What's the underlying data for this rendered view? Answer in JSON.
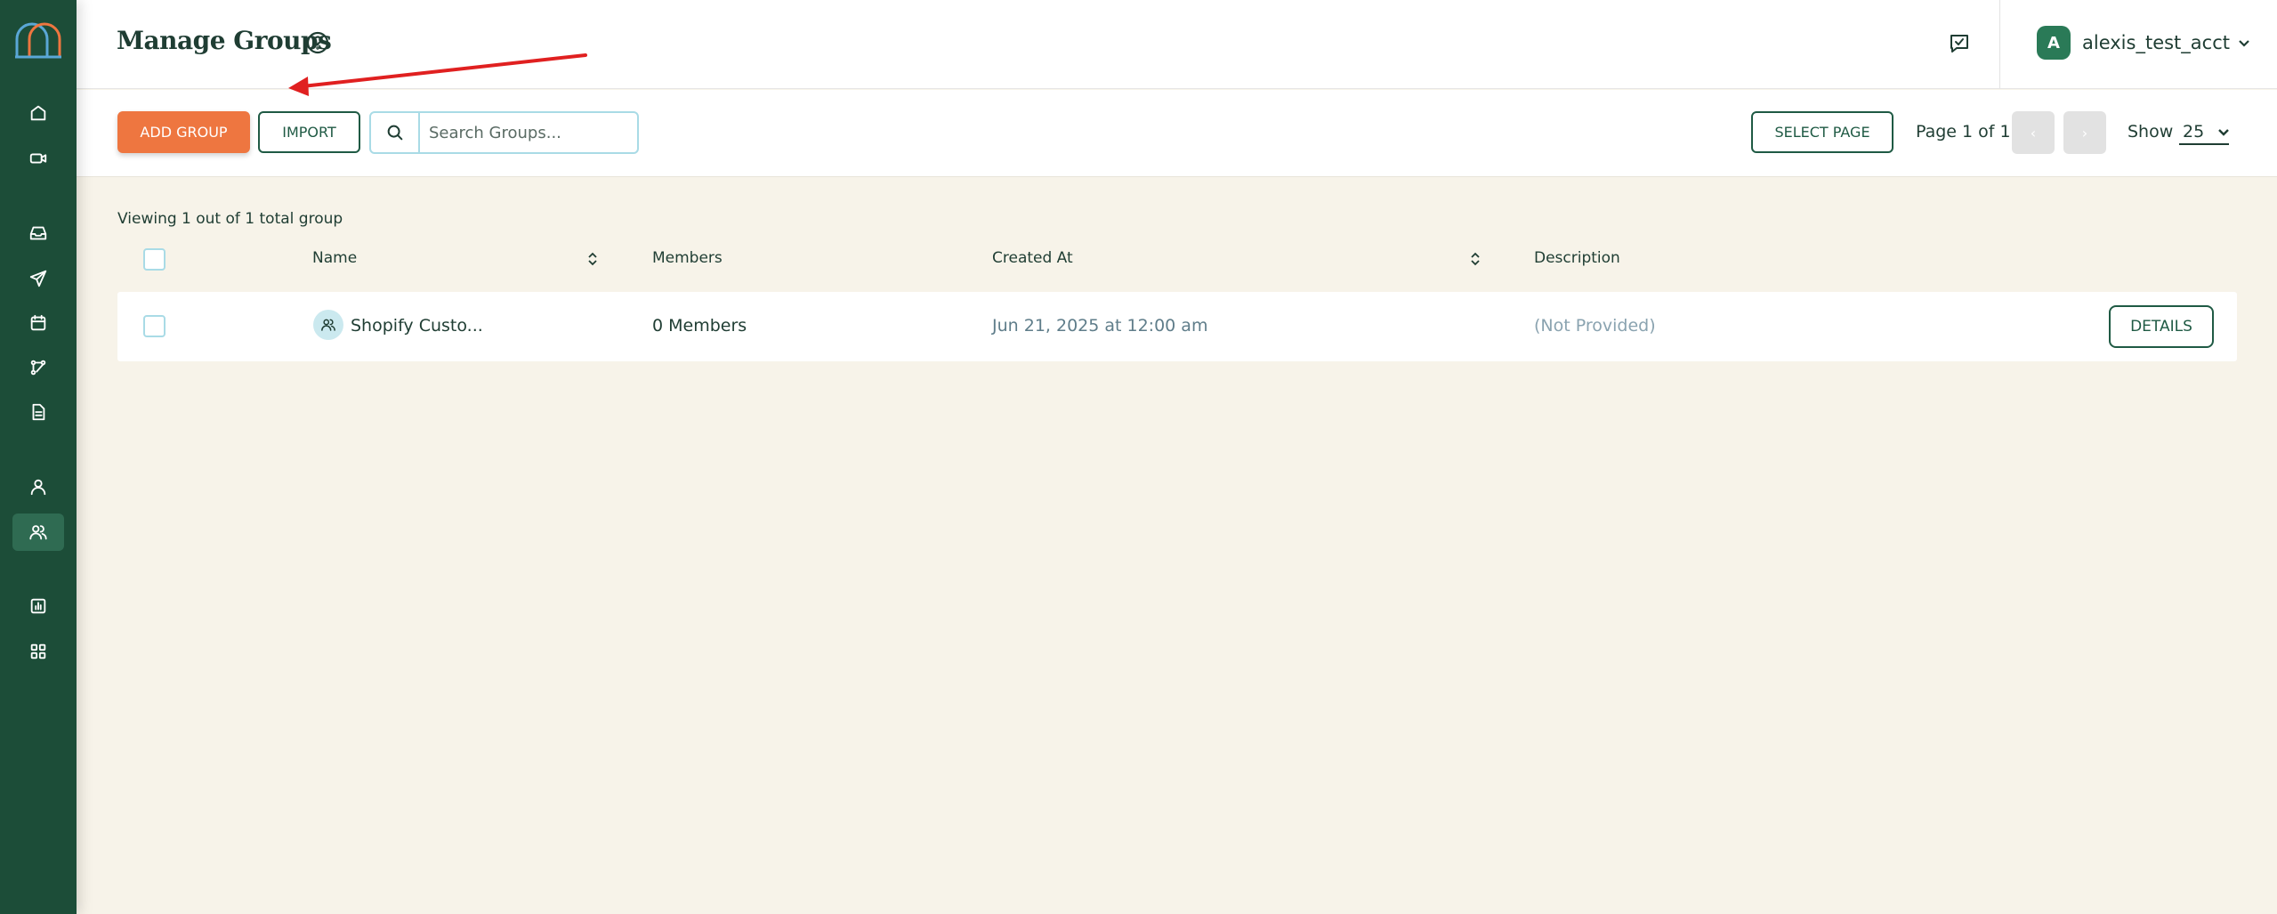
{
  "sidebar": {
    "items": [
      {
        "icon": "home-icon"
      },
      {
        "icon": "video-icon"
      },
      {
        "icon": "inbox-icon"
      },
      {
        "icon": "send-icon"
      },
      {
        "icon": "calendar-icon"
      },
      {
        "icon": "workflow-icon"
      },
      {
        "icon": "document-icon"
      },
      {
        "icon": "contact-icon"
      },
      {
        "icon": "groups-icon",
        "active": true
      },
      {
        "icon": "analytics-icon"
      },
      {
        "icon": "apps-icon"
      }
    ]
  },
  "header": {
    "title": "Manage Groups",
    "account": {
      "initial": "A",
      "name": "alexis_test_acct"
    }
  },
  "toolbar": {
    "add_label": "ADD GROUP",
    "import_label": "IMPORT",
    "search_placeholder": "Search Groups...",
    "select_page_label": "SELECT PAGE",
    "page_info": "Page 1 of 1",
    "prev_label": "‹",
    "next_label": "›",
    "show_label": "Show",
    "show_value": "25"
  },
  "table": {
    "viewing_text": "Viewing 1 out of 1 total group",
    "columns": {
      "name": "Name",
      "members": "Members",
      "created": "Created At",
      "description": "Description"
    },
    "rows": [
      {
        "name": "Shopify Custo...",
        "members": "0 Members",
        "created": "Jun 21, 2025 at 12:00 am",
        "description": "(Not Provided)",
        "action": "DETAILS"
      }
    ]
  },
  "colors": {
    "sidebar": "#1c4d38",
    "accent": "#ee7640",
    "primary": "#1f5a44",
    "background": "#f7f3e9",
    "annotation": "#e02020"
  }
}
